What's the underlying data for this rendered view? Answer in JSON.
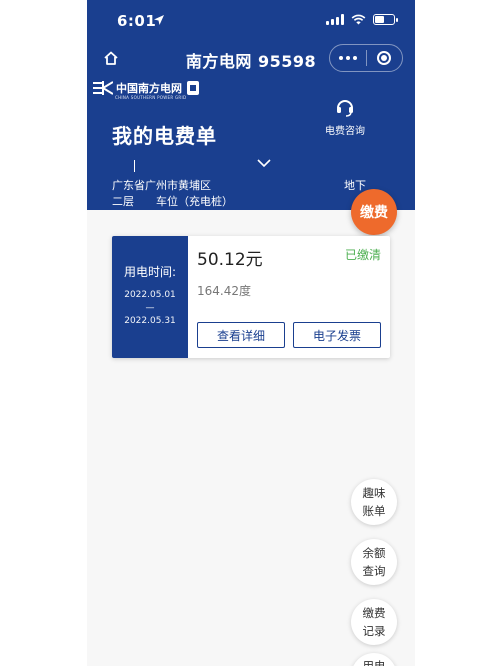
{
  "status_bar": {
    "time": "6:01"
  },
  "nav": {
    "title": "南方电网 95598"
  },
  "logo": {
    "cn": "中国南方电网",
    "en": "CHINA SOUTHERN POWER GRID"
  },
  "page": {
    "title": "我的电费单"
  },
  "consult": {
    "label": "电费咨询"
  },
  "address": {
    "line1": "广东省广州市黄埔区",
    "line1_right": "地下",
    "line2": "二层　　车位（充电桩）"
  },
  "pay_button": {
    "label": "缴费"
  },
  "bill": {
    "period_label": "用电时间:",
    "start_date": "2022.05.01",
    "dash": "—",
    "end_date": "2022.05.31",
    "amount": "50.12元",
    "status": "已缴清",
    "usage": "164.42度",
    "detail_button": "查看详细",
    "invoice_button": "电子发票"
  },
  "side_actions": [
    {
      "label": "趣味\n账单"
    },
    {
      "label": "余额\n查询"
    },
    {
      "label": "缴费\n记录"
    },
    {
      "label": "用电"
    }
  ],
  "colors": {
    "primary": "#1a3f8f",
    "accent": "#ee6a2c",
    "paid": "#4caf50"
  },
  "icons": [
    "location-arrow-icon",
    "signal-icon",
    "wifi-icon",
    "battery-icon",
    "home-icon",
    "more-icon",
    "target-icon",
    "headset-icon",
    "chevron-down-icon",
    "grid-logo-icon"
  ]
}
